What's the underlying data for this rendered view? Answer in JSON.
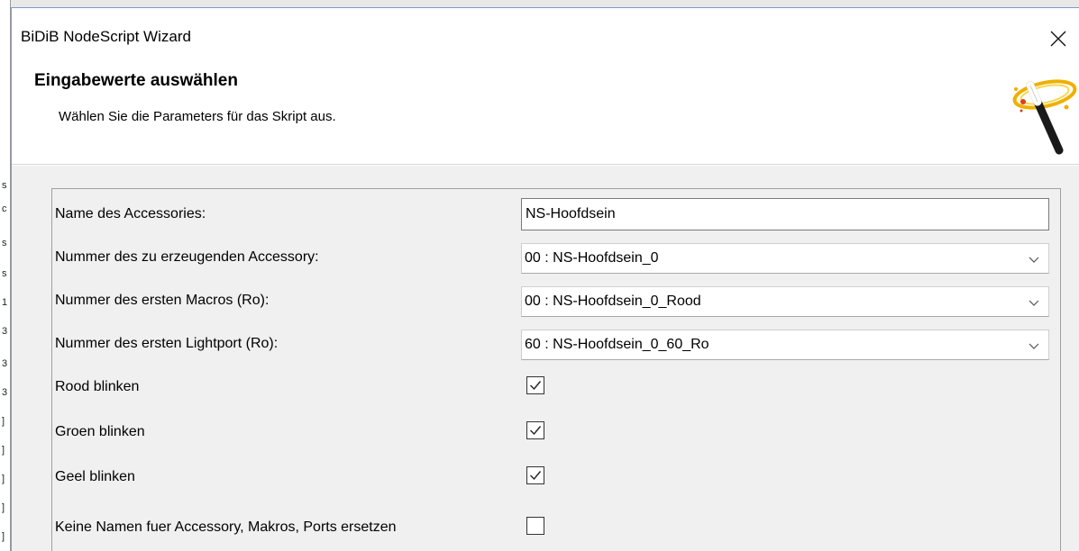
{
  "window": {
    "title": "BiDiB NodeScript Wizard"
  },
  "header": {
    "title": "Eingabewerte auswählen",
    "subtitle": "Wählen Sie die Parameters für das Skript aus.",
    "icon": "magic-wand-icon"
  },
  "form": {
    "name_label": "Name des Accessories:",
    "name_value": "NS-Hoofdsein",
    "accessory_label": "Nummer des zu erzeugenden Accessory:",
    "accessory_value": "00 : NS-Hoofdsein_0",
    "macro_label": "Nummer des ersten Macros (Ro):",
    "macro_value": "00 : NS-Hoofdsein_0_Rood",
    "lightport_label": "Nummer des ersten Lightport (Ro):",
    "lightport_value": "60 : NS-Hoofdsein_0_60_Ro",
    "checkboxes": [
      {
        "label": "Rood blinken",
        "checked": true
      },
      {
        "label": "Groen blinken",
        "checked": true
      },
      {
        "label": "Geel blinken",
        "checked": true
      },
      {
        "label": "Keine Namen fuer Accessory, Makros, Ports ersetzen",
        "checked": false
      }
    ]
  },
  "colors": {
    "content_bg": "#f0f0f0",
    "header_bg": "#ffffff",
    "window_border": "#7a9cc6"
  }
}
